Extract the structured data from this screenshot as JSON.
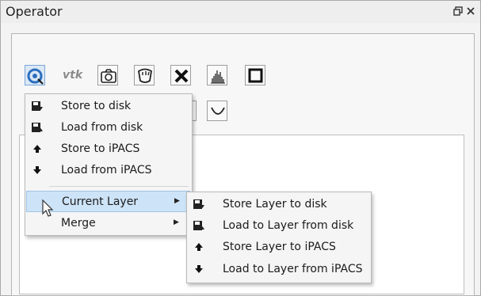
{
  "window": {
    "title": "Operator",
    "float_icon": "float-icon",
    "close_icon": "close-icon"
  },
  "tabs": [
    {
      "icon": "pointer-icon",
      "active": true
    },
    {
      "icon": "dot-icon",
      "active": false
    },
    {
      "icon": "brush-icon",
      "active": false
    },
    {
      "icon": "wand-icon",
      "active": false
    },
    {
      "icon": "layers-icon",
      "active": false
    }
  ],
  "toolbar": {
    "vtk_label": "vtk",
    "tools": [
      "io-icon",
      "vtk-icon",
      "camera-icon",
      "lasso-icon",
      "delete-icon",
      "histogram-icon",
      "crop-icon",
      "curve-icon"
    ]
  },
  "io_menu": {
    "items": [
      {
        "label": "Store to disk",
        "icon": "store-disk-icon"
      },
      {
        "label": "Load from disk",
        "icon": "load-disk-icon"
      },
      {
        "label": "Store to iPACS",
        "icon": "upload-arrow-icon"
      },
      {
        "label": "Load from iPACS",
        "icon": "download-arrow-icon"
      }
    ],
    "submenus": [
      {
        "label": "Current Layer",
        "highlighted": true
      },
      {
        "label": "Merge",
        "highlighted": false
      }
    ]
  },
  "layer_submenu": {
    "items": [
      {
        "label": "Store Layer to disk",
        "icon": "store-disk-icon"
      },
      {
        "label": "Load to Layer from disk",
        "icon": "load-disk-icon"
      },
      {
        "label": "Store Layer to iPACS",
        "icon": "upload-arrow-icon"
      },
      {
        "label": "Load to Layer from iPACS",
        "icon": "download-arrow-icon"
      }
    ]
  }
}
